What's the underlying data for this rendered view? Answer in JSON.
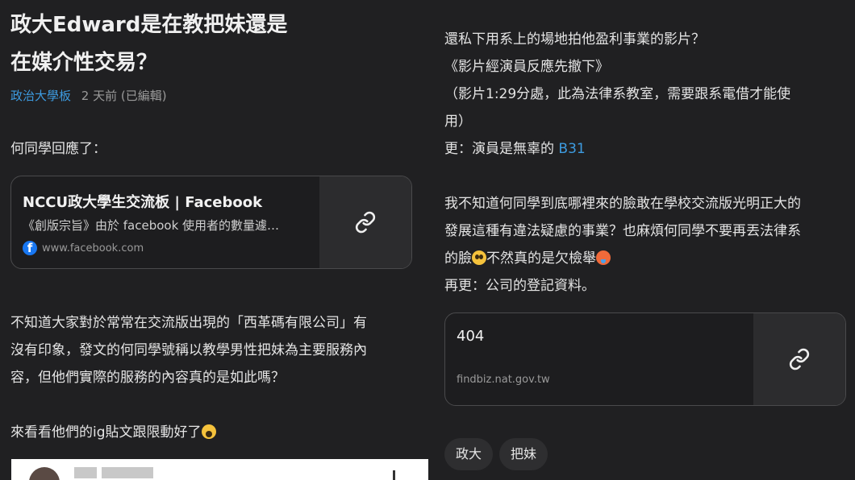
{
  "post": {
    "title_line1": "政大Edward是在教把妹還是",
    "title_line2": "在媒介性交易？",
    "board": "政治大學板",
    "time": "2 天前 (已編輯)"
  },
  "left": {
    "intro": "何同學回應了：",
    "link_card": {
      "title": "NCCU政大學生交流板 | Facebook",
      "description": "《創版宗旨》由於 facebook 使用者的數量遽…",
      "url": "www.facebook.com",
      "site_icon": "facebook-icon",
      "action_icon": "link-icon"
    },
    "paragraph_lines": [
      "不知道大家對於常常在交流版出現的「西革碼有限公司」有",
      "沒有印象，發文的何同學號稱以教學男性把妹為主要服務內",
      "容，但他們實際的服務的內容真的是如此嗎？"
    ],
    "ig_line": "來看看他們的ig貼文跟限動好了",
    "ig_line_emoji": "shocked-face-icon"
  },
  "right": {
    "line1": "還私下用系上的場地拍他盈利事業的影片？",
    "line2": "《影片經演員反應先撤下》",
    "line3": "（影片1:29分處，此為法律系教室，需要跟系電借才能使",
    "line4": "用）",
    "line5_prefix": "更：演員是無辜的 ",
    "line5_link": "B31",
    "para2_line1": "我不知道何同學到底哪裡來的臉敢在學校交流版光明正大的",
    "para2_line2": "發展這種有違法疑慮的事業？也麻煩何同學不要再丟法律系",
    "para2_line3_a": "的臉",
    "para2_line3_b": "不然真的是欠檢舉",
    "emoji_pleading": "pleading-face-icon",
    "emoji_hot": "hot-face-icon",
    "para2_line4": "再更：公司的登記資料。",
    "link_card": {
      "title": "404",
      "url": "findbiz.nat.gov.tw",
      "action_icon": "link-icon"
    },
    "tags": [
      "政大",
      "把妹"
    ]
  },
  "colors": {
    "background": "#202022",
    "link": "#3d9be0",
    "card_side": "#2c2c2e"
  }
}
